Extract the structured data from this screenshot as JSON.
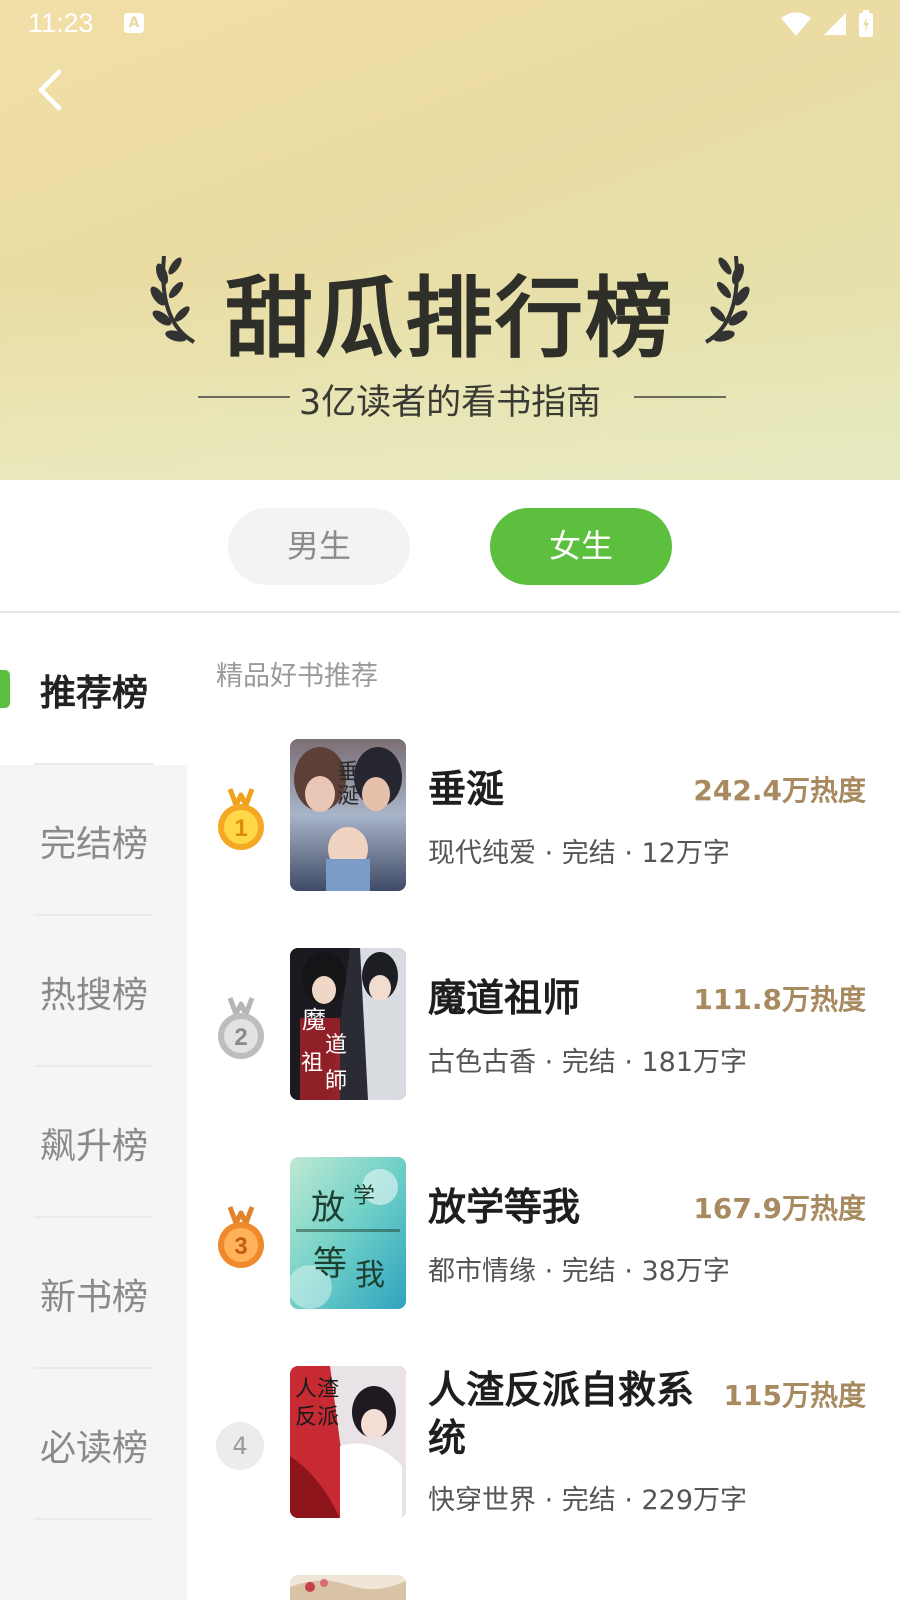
{
  "status_bar": {
    "time": "11:23",
    "notification_glyph": "A"
  },
  "banner": {
    "title": "甜瓜排行榜",
    "subtitle": "3亿读者的看书指南"
  },
  "gender_tabs": {
    "male": "男生",
    "female": "女生",
    "selected": "女生"
  },
  "sidebar": {
    "items": [
      {
        "label": "推荐榜",
        "active": true
      },
      {
        "label": "完结榜",
        "active": false
      },
      {
        "label": "热搜榜",
        "active": false
      },
      {
        "label": "飙升榜",
        "active": false
      },
      {
        "label": "新书榜",
        "active": false
      },
      {
        "label": "必读榜",
        "active": false
      }
    ]
  },
  "list": {
    "section_title": "精品好书推荐",
    "books": [
      {
        "rank": "1",
        "medal": "gold-medal-icon",
        "title": "垂涎",
        "heat": "242.4万热度",
        "meta": "现代纯爱 · 完结 · 12万字"
      },
      {
        "rank": "2",
        "medal": "silver-medal-icon",
        "title": "魔道祖师",
        "heat": "111.8万热度",
        "meta": "古色古香 · 完结 · 181万字"
      },
      {
        "rank": "3",
        "medal": "bronze-medal-icon",
        "title": "放学等我",
        "heat": "167.9万热度",
        "meta": "都市情缘 · 完结 · 38万字"
      },
      {
        "rank": "4",
        "medal": "",
        "title": "人渣反派自救系统",
        "heat": "115万热度",
        "meta": "快穿世界 · 完结 · 229万字"
      }
    ]
  },
  "colors": {
    "accent_green": "#5cbf3e",
    "heat_gold": "#a88a60",
    "banner_bg": "#eadca3"
  }
}
